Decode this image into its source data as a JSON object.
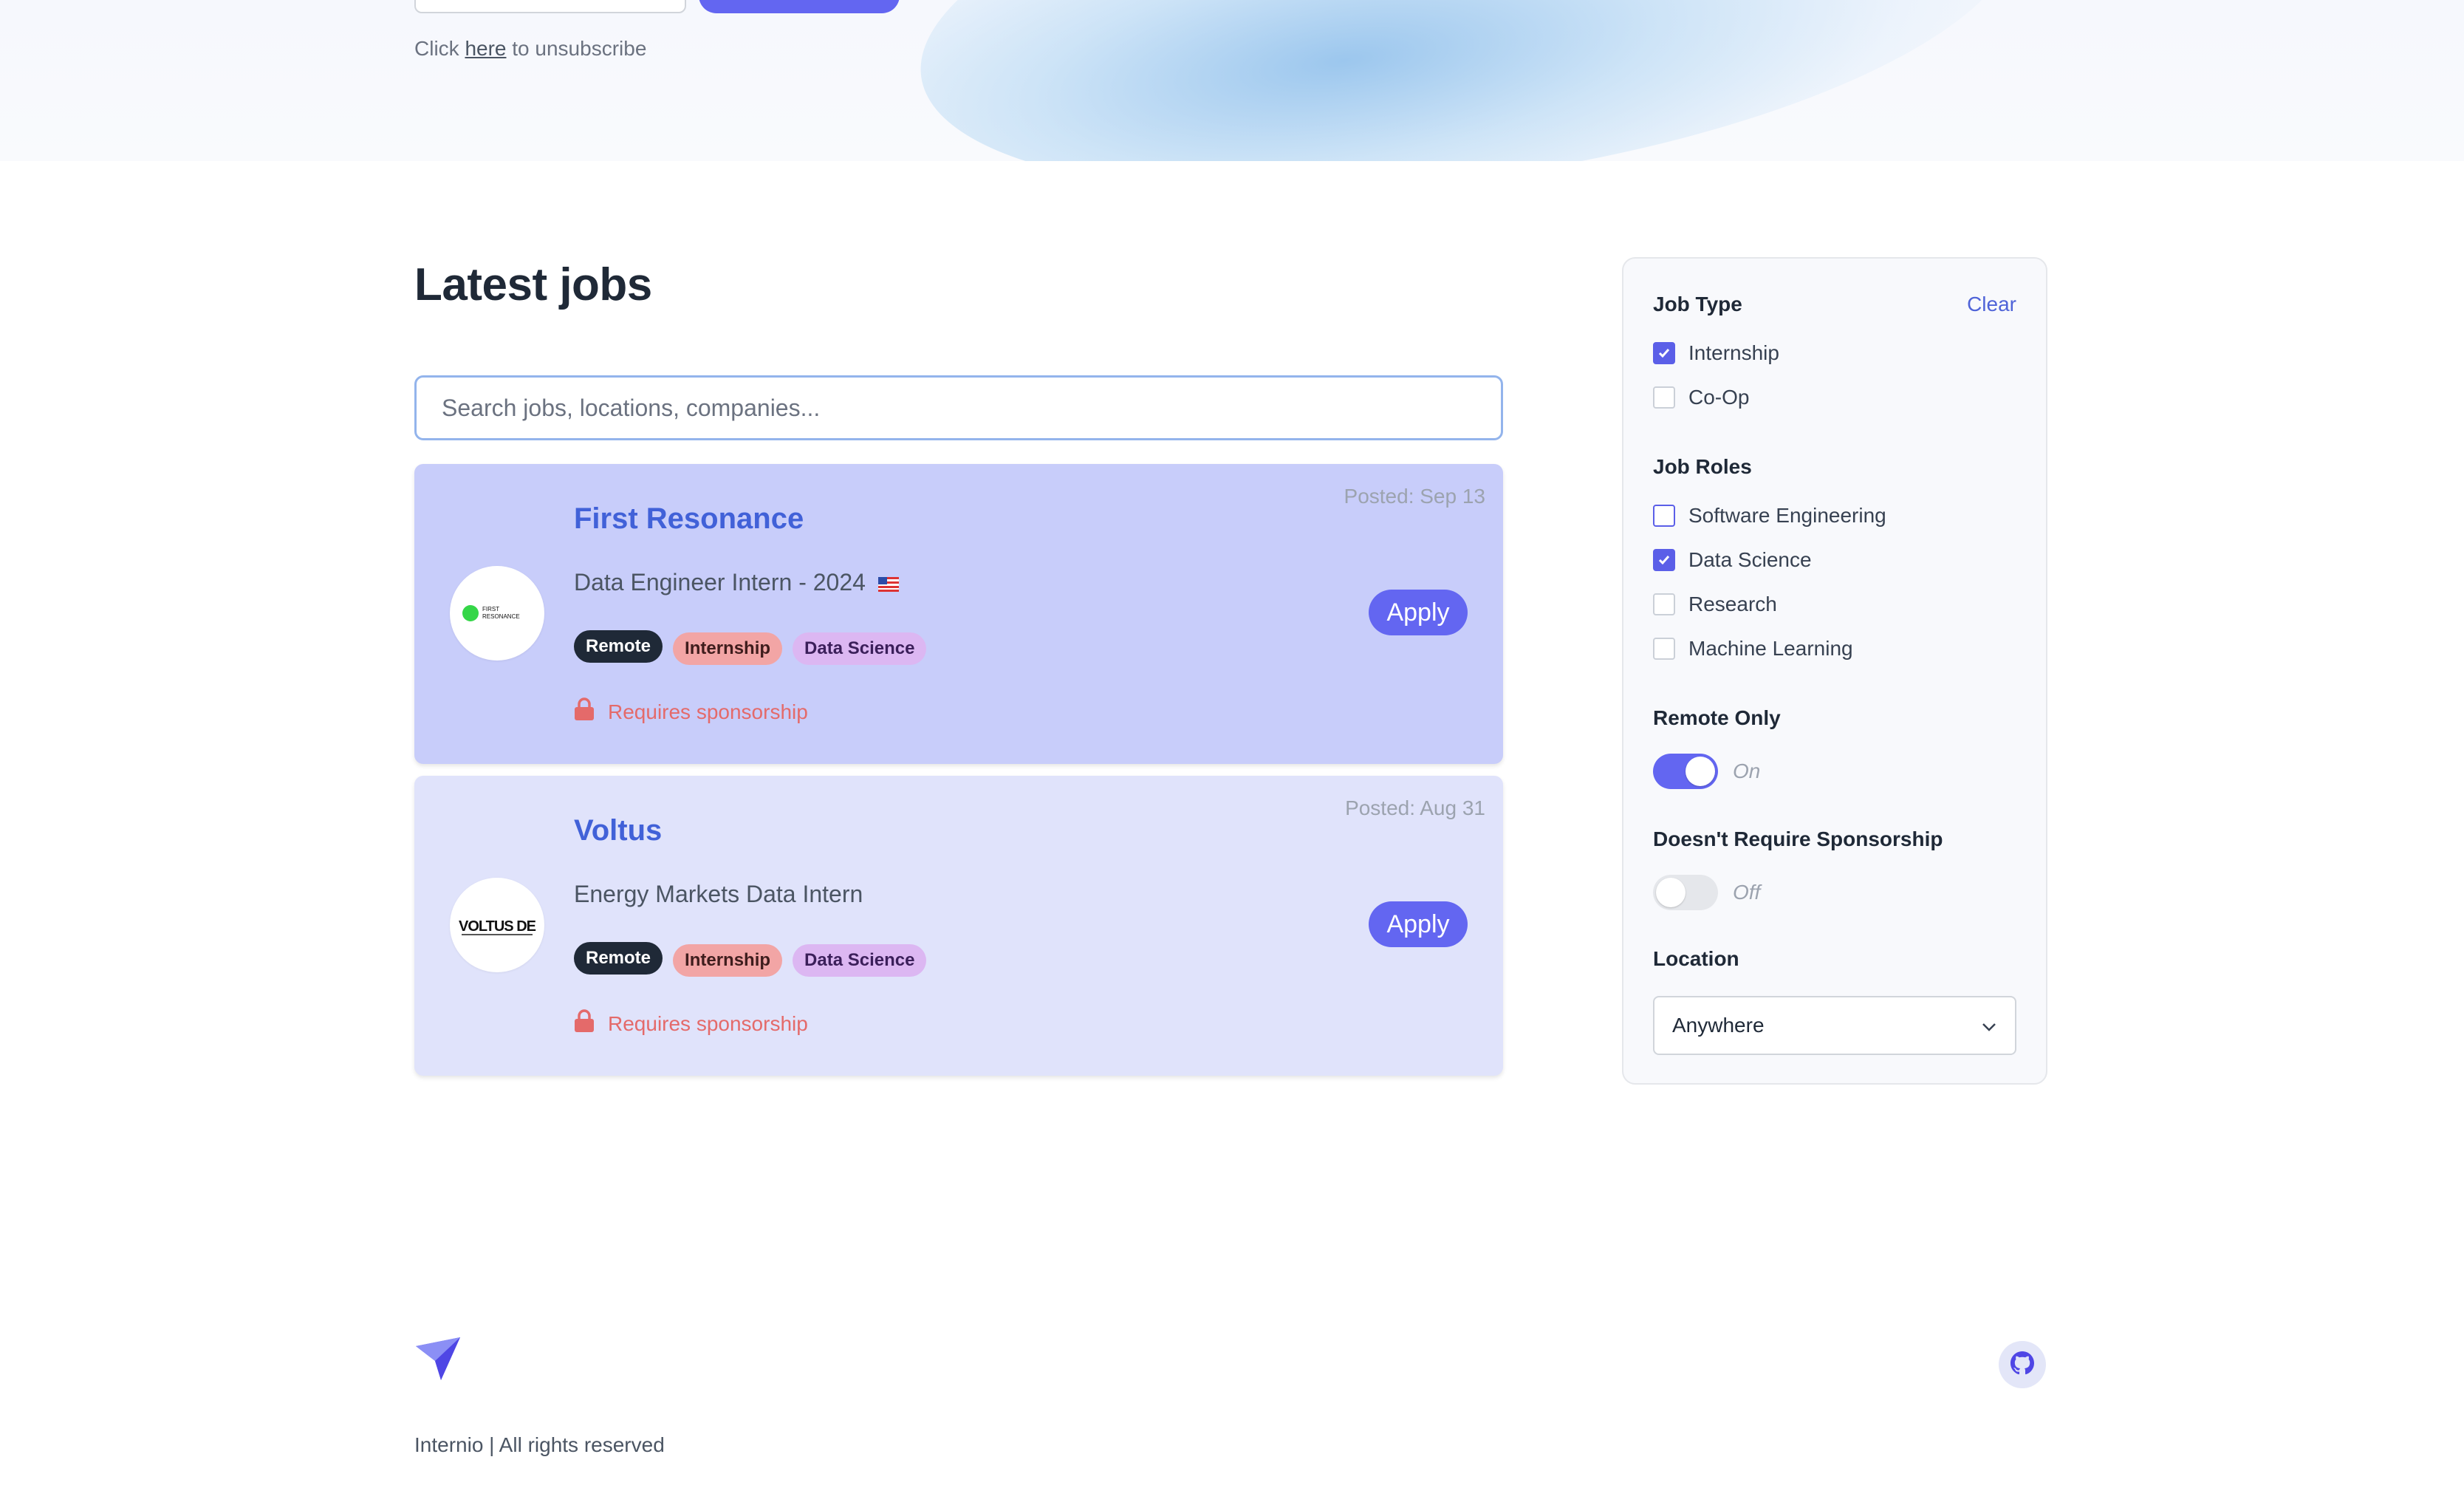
{
  "subscribe": {
    "prefix": "Click",
    "link_label": "here",
    "suffix": "to unsubscribe"
  },
  "main": {
    "title": "Latest jobs",
    "search_placeholder": "Search jobs, locations, companies..."
  },
  "jobs": [
    {
      "company": "First Resonance",
      "title": "Data Engineer Intern - 2024",
      "flag": "us-flag-icon",
      "posted": "Posted: Sep 13",
      "logo_text": "FIRST RESONANCE",
      "tags": [
        "Remote",
        "Internship",
        "Data Science"
      ],
      "sponsorship": "Requires sponsorship",
      "apply_label": "Apply"
    },
    {
      "company": "Voltus",
      "title": "Energy Markets Data Intern",
      "posted": "Posted: Aug 31",
      "logo_text": "VOLTUS DE",
      "tags": [
        "Remote",
        "Internship",
        "Data Science"
      ],
      "sponsorship": "Requires sponsorship",
      "apply_label": "Apply"
    }
  ],
  "filters": {
    "job_type": {
      "heading": "Job Type",
      "clear_label": "Clear",
      "options": [
        {
          "label": "Internship",
          "checked": true
        },
        {
          "label": "Co-Op",
          "checked": false
        }
      ]
    },
    "job_roles": {
      "heading": "Job Roles",
      "options": [
        {
          "label": "Software Engineering",
          "checked": false
        },
        {
          "label": "Data Science",
          "checked": true
        },
        {
          "label": "Research",
          "checked": false
        },
        {
          "label": "Machine Learning",
          "checked": false
        }
      ]
    },
    "remote_only": {
      "heading": "Remote Only",
      "state_label": "On",
      "on": true
    },
    "sponsorship": {
      "heading": "Doesn't Require Sponsorship",
      "state_label": "Off",
      "on": false
    },
    "location": {
      "heading": "Location",
      "selected": "Anywhere"
    }
  },
  "footer": {
    "copyright": "Internio | All rights reserved",
    "logo_icon": "paper-plane-icon",
    "github_icon": "github-icon"
  },
  "colors": {
    "accent": "#6366f1",
    "company_link": "#4161d8",
    "card_highlight": "#c8cdfa",
    "card_default": "#e0e3fb",
    "sponsorship_red": "#e46a6a"
  }
}
